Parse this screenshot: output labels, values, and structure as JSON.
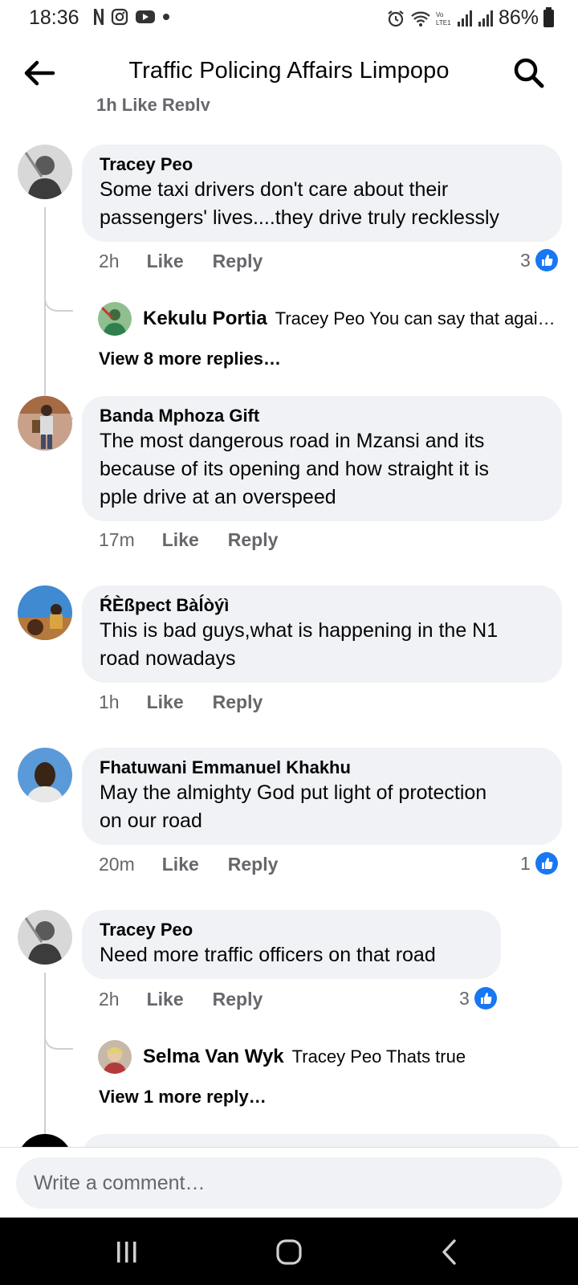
{
  "status_bar": {
    "time": "18:36",
    "battery": "86%",
    "icons_left": [
      "netflix-icon",
      "instagram-icon",
      "youtube-icon",
      "dot-icon"
    ],
    "icons_right": [
      "alarm-icon",
      "wifi-icon",
      "volte-icon",
      "signal-icon",
      "signal-icon",
      "battery-icon"
    ]
  },
  "header": {
    "title": "Traffic Policing Affairs Limpopo",
    "back_icon": "back-arrow-icon",
    "search_icon": "search-icon"
  },
  "partial_top": {
    "text": "1h   Like   Reply"
  },
  "comments": [
    {
      "author": "Tracey Peo",
      "text_lines": [
        "Some taxi drivers don't care about their",
        "passengers' lives....they drive truly recklessly"
      ],
      "time": "2h",
      "like": "Like",
      "reply": "Reply",
      "reactions": "3",
      "replies": {
        "name": "Kekulu Portia",
        "text": "Tracey Peo You can say that agai…",
        "view_more": "View 8 more replies…"
      }
    },
    {
      "author": "Banda Mphoza Gift",
      "text_lines": [
        "The most dangerous road in Mzansi and its",
        "because of its opening and how straight it is",
        "pple drive at an overspeed"
      ],
      "time": "17m",
      "like": "Like",
      "reply": "Reply"
    },
    {
      "author": "ŔÈßpect Bàĺòýì",
      "text_lines": [
        "This is bad guys,what is happening in the N1",
        "road nowadays"
      ],
      "time": "1h",
      "like": "Like",
      "reply": "Reply"
    },
    {
      "author": "Fhatuwani Emmanuel Khakhu",
      "text_lines": [
        "May the almighty God put light of protection",
        "on our road"
      ],
      "time": "20m",
      "like": "Like",
      "reply": "Reply",
      "reactions": "1"
    },
    {
      "author": "Tracey Peo",
      "text_lines": [
        "Need more traffic officers on that road"
      ],
      "time": "2h",
      "like": "Like",
      "reply": "Reply",
      "reactions": "3",
      "replies": {
        "name": "Selma Van Wyk",
        "text": "Tracey Peo  Thats true",
        "view_more": "View 1 more reply…"
      }
    }
  ],
  "composer": {
    "placeholder": "Write a comment…"
  },
  "nav_bar": {
    "icons": [
      "recent-apps-icon",
      "home-icon",
      "back-nav-icon"
    ]
  },
  "colors": {
    "accent": "#1877f2",
    "bubble": "#f0f2f5",
    "secondary_text": "#65676b"
  }
}
